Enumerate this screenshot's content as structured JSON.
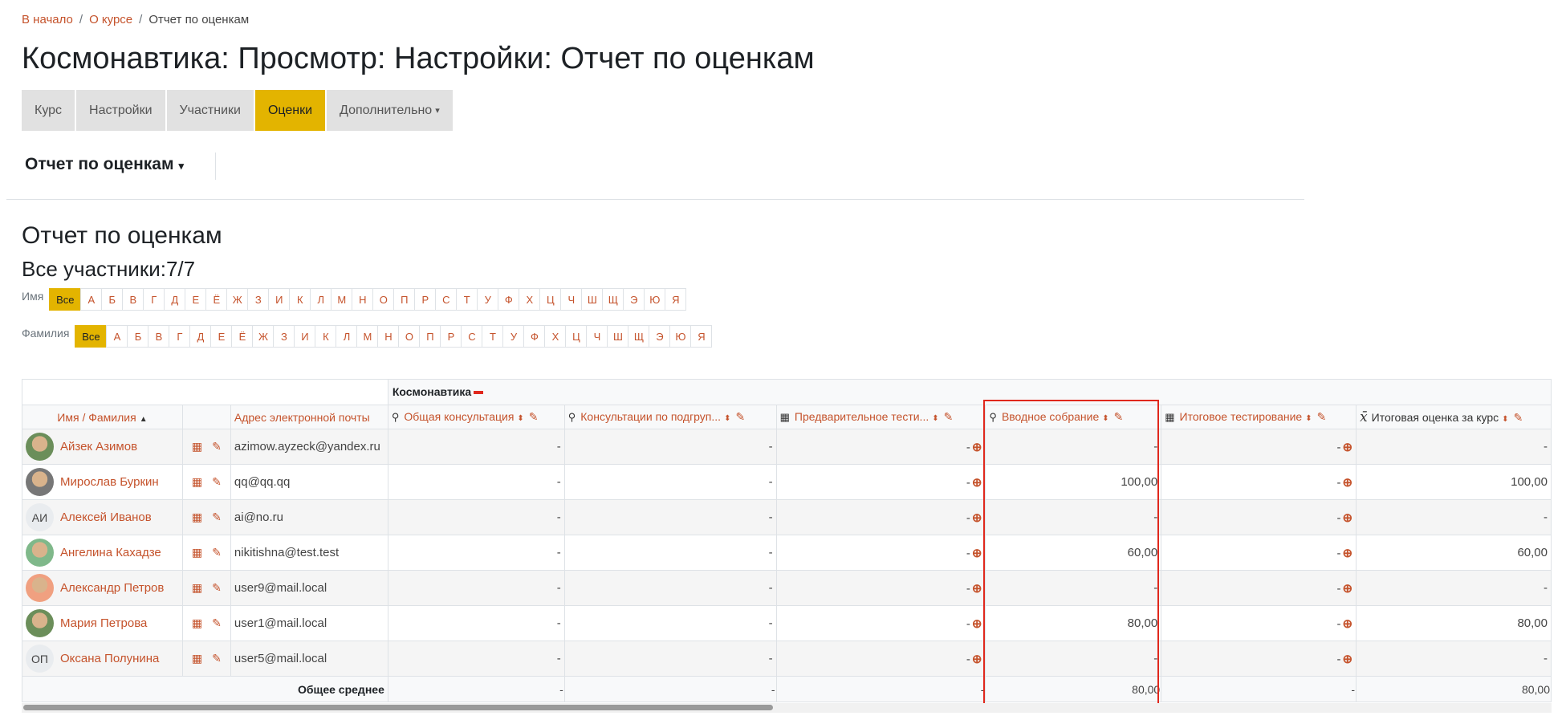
{
  "breadcrumb": {
    "home": "В начало",
    "course": "О курсе",
    "current": "Отчет по оценкам"
  },
  "page_title": "Космонавтика: Просмотр: Настройки: Отчет по оценкам",
  "tabs": [
    {
      "label": "Курс",
      "active": false
    },
    {
      "label": "Настройки",
      "active": false
    },
    {
      "label": "Участники",
      "active": false
    },
    {
      "label": "Оценки",
      "active": true
    },
    {
      "label": "Дополнительно",
      "active": false,
      "dropdown": true
    }
  ],
  "report_selector": "Отчет по оценкам",
  "section_title": "Отчет по оценкам",
  "participants": "Все участники:7/7",
  "first_name_filter": {
    "label": "Имя",
    "all": "Все"
  },
  "last_name_filter": {
    "label": "Фамилия",
    "all": "Все"
  },
  "letters": [
    "А",
    "Б",
    "В",
    "Г",
    "Д",
    "Е",
    "Ё",
    "Ж",
    "З",
    "И",
    "К",
    "Л",
    "М",
    "Н",
    "О",
    "П",
    "Р",
    "С",
    "Т",
    "У",
    "Ф",
    "Х",
    "Ц",
    "Ч",
    "Ш",
    "Щ",
    "Э",
    "Ю",
    "Я"
  ],
  "grade_table": {
    "category": "Космонавтика",
    "col_name": "Имя / Фамилия",
    "col_email": "Адрес электронной почты",
    "items": [
      {
        "label": "Общая консультация",
        "icon": "attendance-icon"
      },
      {
        "label": "Консультации по подгруп...",
        "icon": "attendance-icon"
      },
      {
        "label": "Предварительное тести...",
        "icon": "quiz-icon"
      },
      {
        "label": "Вводное собрание",
        "icon": "attendance-icon"
      },
      {
        "label": "Итоговое тестирование",
        "icon": "quiz-icon"
      },
      {
        "label": "Итоговая оценка за курс",
        "icon": "sigma-icon"
      }
    ],
    "rows": [
      {
        "name": "Айзек Азимов",
        "email": "azimow.ayzeck@yandex.ru",
        "avatar": "photo",
        "initials": "",
        "grades": [
          "-",
          "-",
          "-",
          "-",
          "-",
          "-"
        ]
      },
      {
        "name": "Мирослав Буркин",
        "email": "qq@qq.qq",
        "avatar": "photo",
        "initials": "",
        "grades": [
          "-",
          "-",
          "-",
          "100,00",
          "-",
          "100,00"
        ]
      },
      {
        "name": "Алексей Иванов",
        "email": "ai@no.ru",
        "avatar": "initials",
        "initials": "АИ",
        "grades": [
          "-",
          "-",
          "-",
          "-",
          "-",
          "-"
        ]
      },
      {
        "name": "Ангелина Кахадзе",
        "email": "nikitishna@test.test",
        "avatar": "photo",
        "initials": "",
        "grades": [
          "-",
          "-",
          "-",
          "60,00",
          "-",
          "60,00"
        ]
      },
      {
        "name": "Александр Петров",
        "email": "user9@mail.local",
        "avatar": "photo",
        "initials": "",
        "grades": [
          "-",
          "-",
          "-",
          "-",
          "-",
          "-"
        ]
      },
      {
        "name": "Мария Петрова",
        "email": "user1@mail.local",
        "avatar": "photo",
        "initials": "",
        "grades": [
          "-",
          "-",
          "-",
          "80,00",
          "-",
          "80,00"
        ]
      },
      {
        "name": "Оксана Полунина",
        "email": "user5@mail.local",
        "avatar": "initials",
        "initials": "ОП",
        "grades": [
          "-",
          "-",
          "-",
          "-",
          "-",
          "-"
        ]
      }
    ],
    "average_label": "Общее среднее",
    "averages": [
      "-",
      "-",
      "-",
      "80,00",
      "-",
      "80,00"
    ]
  },
  "colors": {
    "accent": "#e3b400",
    "link": "#c5532c",
    "highlight": "#e0281d"
  }
}
